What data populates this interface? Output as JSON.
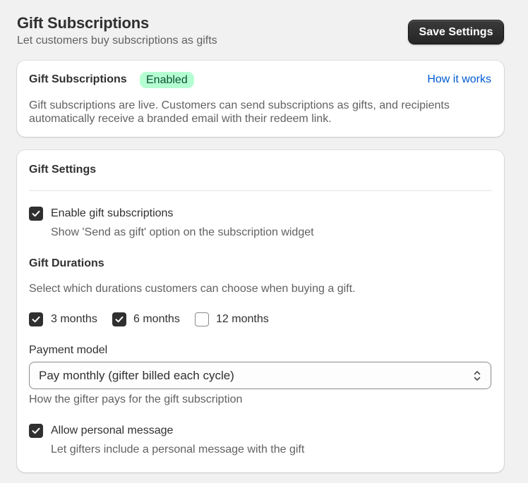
{
  "header": {
    "title": "Gift Subscriptions",
    "subtitle": "Let customers buy subscriptions as gifts",
    "save_label": "Save Settings"
  },
  "status_card": {
    "title": "Gift Subscriptions",
    "badge": "Enabled",
    "link": "How it works",
    "description": "Gift subscriptions are live. Customers can send subscriptions as gifts, and recipients automatically receive a branded email with their redeem link."
  },
  "settings_card": {
    "title": "Gift Settings",
    "enable": {
      "label": "Enable gift subscriptions",
      "help": "Show 'Send as gift' option on the subscription widget",
      "checked": true
    },
    "durations": {
      "title": "Gift Durations",
      "help": "Select which durations customers can choose when buying a gift.",
      "options": [
        {
          "label": "3 months",
          "checked": true
        },
        {
          "label": "6 months",
          "checked": true
        },
        {
          "label": "12 months",
          "checked": false
        }
      ]
    },
    "payment": {
      "label": "Payment model",
      "value": "Pay monthly (gifter billed each cycle)",
      "help": "How the gifter pays for the gift subscription"
    },
    "personal_message": {
      "label": "Allow personal message",
      "help": "Let gifters include a personal message with the gift",
      "checked": true
    }
  },
  "colors": {
    "background": "#f1f1f1",
    "badge_bg": "#b4fed2",
    "badge_text": "#0c5132",
    "link": "#005bd3",
    "checkbox_on": "#303030"
  }
}
